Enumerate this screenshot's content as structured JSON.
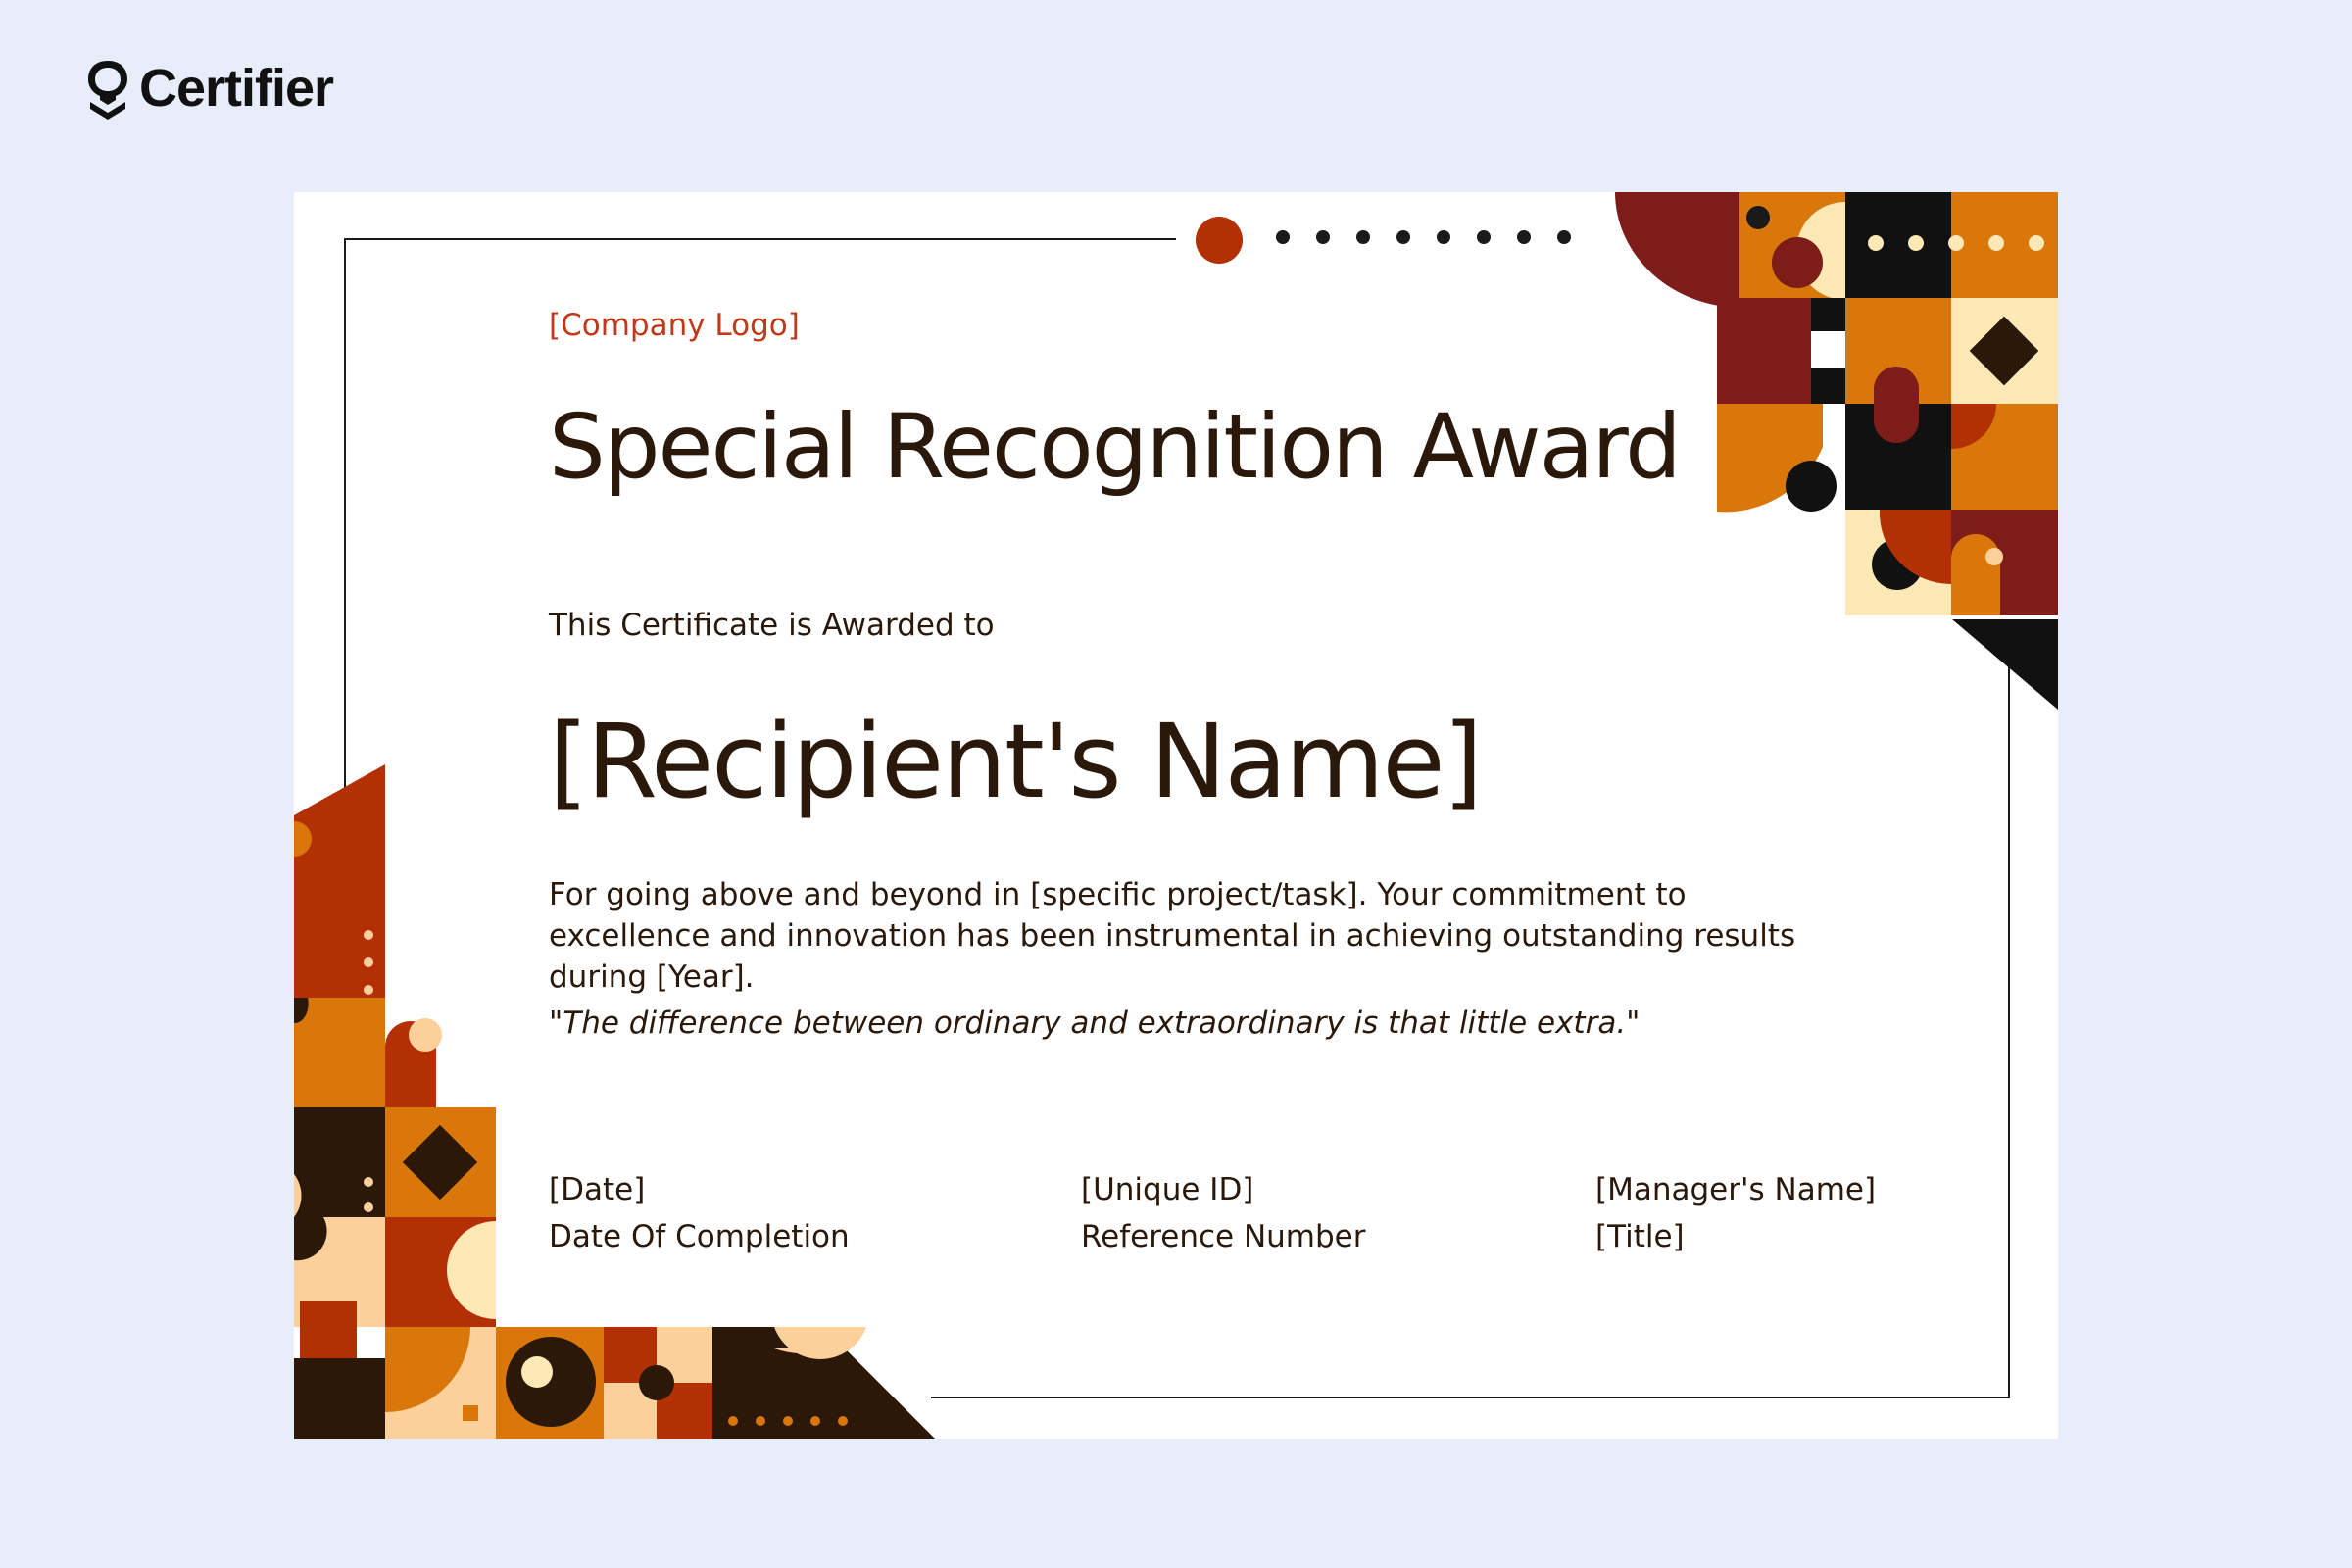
{
  "brand": {
    "name": "Certifier"
  },
  "certificate": {
    "company_logo": "[Company Logo]",
    "title": "Special Recognition Award",
    "awarded_to": "This Certificate is Awarded to",
    "recipient": "[Recipient's Name]",
    "description": "For going above and beyond in [specific project/task]. Your commitment to excellence and innovation has been instrumental in achieving outstanding results during [Year].",
    "quote": "\"The difference between ordinary and extraordinary is that little extra.\"",
    "signatures": [
      {
        "value": "[Date]",
        "label": "Date Of Completion"
      },
      {
        "value": "[Unique ID]",
        "label": "Reference Number"
      },
      {
        "value": "[Manager's Name]",
        "label": "[Title]"
      }
    ]
  },
  "colors": {
    "page_background": "#e8edfc",
    "accent_red": "#b33005",
    "maroon": "#7e1c19",
    "orange": "#d9770b",
    "cream": "#fde8b6",
    "peach": "#fbd09a",
    "dark_brown": "#2b1808",
    "text": "#2a190b"
  }
}
